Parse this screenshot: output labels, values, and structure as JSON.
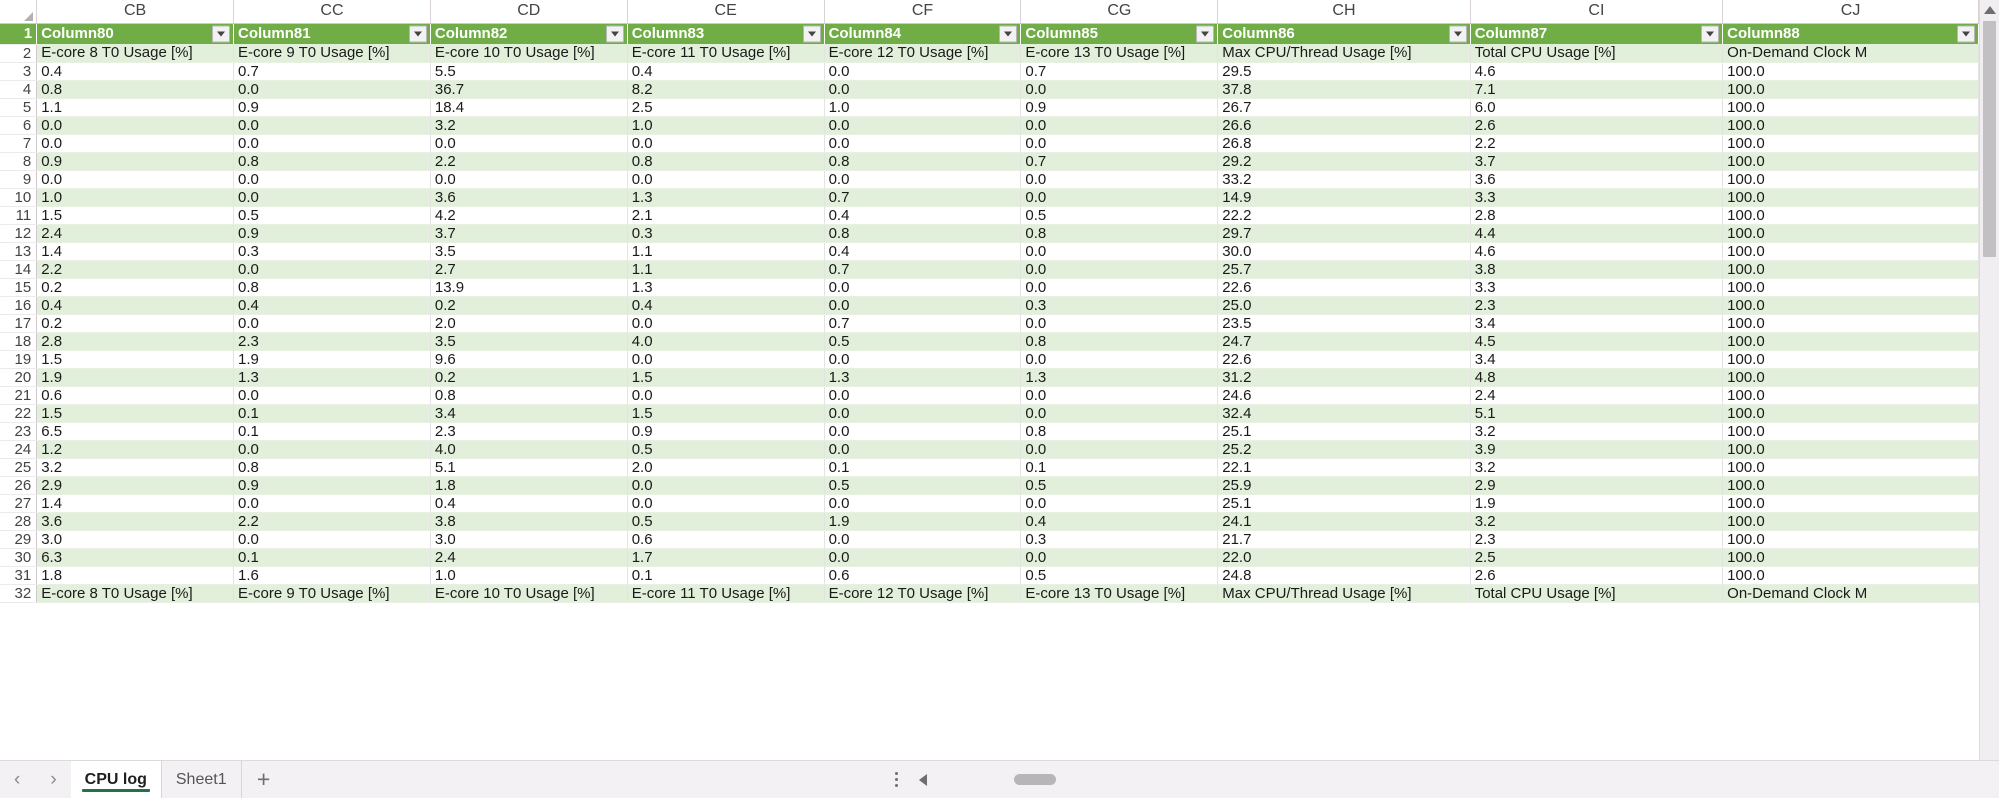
{
  "app": {
    "name": "Microsoft Excel",
    "corner_icon": "select-all-icon"
  },
  "grid": {
    "column_letters": [
      "CB",
      "CC",
      "CD",
      "CE",
      "CF",
      "CG",
      "CH",
      "CI",
      "CJ"
    ],
    "row_numbers": [
      "1",
      "2",
      "3",
      "4",
      "5",
      "6",
      "7",
      "8",
      "9",
      "10",
      "11",
      "12",
      "13",
      "14",
      "15",
      "16",
      "17",
      "18",
      "19",
      "20",
      "21",
      "22",
      "23",
      "24",
      "25",
      "26",
      "27",
      "28",
      "29",
      "30",
      "31",
      "32"
    ],
    "table_headers": [
      "Column80",
      "Column81",
      "Column82",
      "Column83",
      "Column84",
      "Column85",
      "Column86",
      "Column87",
      "Column88"
    ],
    "filter_icon": "filter-dropdown-icon",
    "label_row": [
      "E-core 8 T0 Usage [%]",
      "E-core 9 T0 Usage [%]",
      "E-core 10 T0 Usage [%]",
      "E-core 11 T0 Usage [%]",
      "E-core 12 T0 Usage [%]",
      "E-core 13 T0 Usage [%]",
      "Max CPU/Thread Usage [%]",
      "Total CPU Usage [%]",
      "On-Demand Clock M"
    ],
    "data_rows": [
      [
        "0.4",
        "0.7",
        "5.5",
        "0.4",
        "0.0",
        "0.7",
        "29.5",
        "4.6",
        "100.0"
      ],
      [
        "0.8",
        "0.0",
        "36.7",
        "8.2",
        "0.0",
        "0.0",
        "37.8",
        "7.1",
        "100.0"
      ],
      [
        "1.1",
        "0.9",
        "18.4",
        "2.5",
        "1.0",
        "0.9",
        "26.7",
        "6.0",
        "100.0"
      ],
      [
        "0.0",
        "0.0",
        "3.2",
        "1.0",
        "0.0",
        "0.0",
        "26.6",
        "2.6",
        "100.0"
      ],
      [
        "0.0",
        "0.0",
        "0.0",
        "0.0",
        "0.0",
        "0.0",
        "26.8",
        "2.2",
        "100.0"
      ],
      [
        "0.9",
        "0.8",
        "2.2",
        "0.8",
        "0.8",
        "0.7",
        "29.2",
        "3.7",
        "100.0"
      ],
      [
        "0.0",
        "0.0",
        "0.0",
        "0.0",
        "0.0",
        "0.0",
        "33.2",
        "3.6",
        "100.0"
      ],
      [
        "1.0",
        "0.0",
        "3.6",
        "1.3",
        "0.7",
        "0.0",
        "14.9",
        "3.3",
        "100.0"
      ],
      [
        "1.5",
        "0.5",
        "4.2",
        "2.1",
        "0.4",
        "0.5",
        "22.2",
        "2.8",
        "100.0"
      ],
      [
        "2.4",
        "0.9",
        "3.7",
        "0.3",
        "0.8",
        "0.8",
        "29.7",
        "4.4",
        "100.0"
      ],
      [
        "1.4",
        "0.3",
        "3.5",
        "1.1",
        "0.4",
        "0.0",
        "30.0",
        "4.6",
        "100.0"
      ],
      [
        "2.2",
        "0.0",
        "2.7",
        "1.1",
        "0.7",
        "0.0",
        "25.7",
        "3.8",
        "100.0"
      ],
      [
        "0.2",
        "0.8",
        "13.9",
        "1.3",
        "0.0",
        "0.0",
        "22.6",
        "3.3",
        "100.0"
      ],
      [
        "0.4",
        "0.4",
        "0.2",
        "0.4",
        "0.0",
        "0.3",
        "25.0",
        "2.3",
        "100.0"
      ],
      [
        "0.2",
        "0.0",
        "2.0",
        "0.0",
        "0.7",
        "0.0",
        "23.5",
        "3.4",
        "100.0"
      ],
      [
        "2.8",
        "2.3",
        "3.5",
        "4.0",
        "0.5",
        "0.8",
        "24.7",
        "4.5",
        "100.0"
      ],
      [
        "1.5",
        "1.9",
        "9.6",
        "0.0",
        "0.0",
        "0.0",
        "22.6",
        "3.4",
        "100.0"
      ],
      [
        "1.9",
        "1.3",
        "0.2",
        "1.5",
        "1.3",
        "1.3",
        "31.2",
        "4.8",
        "100.0"
      ],
      [
        "0.6",
        "0.0",
        "0.8",
        "0.0",
        "0.0",
        "0.0",
        "24.6",
        "2.4",
        "100.0"
      ],
      [
        "1.5",
        "0.1",
        "3.4",
        "1.5",
        "0.0",
        "0.0",
        "32.4",
        "5.1",
        "100.0"
      ],
      [
        "6.5",
        "0.1",
        "2.3",
        "0.9",
        "0.0",
        "0.8",
        "25.1",
        "3.2",
        "100.0"
      ],
      [
        "1.2",
        "0.0",
        "4.0",
        "0.5",
        "0.0",
        "0.0",
        "25.2",
        "3.9",
        "100.0"
      ],
      [
        "3.2",
        "0.8",
        "5.1",
        "2.0",
        "0.1",
        "0.1",
        "22.1",
        "3.2",
        "100.0"
      ],
      [
        "2.9",
        "0.9",
        "1.8",
        "0.0",
        "0.5",
        "0.5",
        "25.9",
        "2.9",
        "100.0"
      ],
      [
        "1.4",
        "0.0",
        "0.4",
        "0.0",
        "0.0",
        "0.0",
        "25.1",
        "1.9",
        "100.0"
      ],
      [
        "3.6",
        "2.2",
        "3.8",
        "0.5",
        "1.9",
        "0.4",
        "24.1",
        "3.2",
        "100.0"
      ],
      [
        "3.0",
        "0.0",
        "3.0",
        "0.6",
        "0.0",
        "0.3",
        "21.7",
        "2.3",
        "100.0"
      ],
      [
        "6.3",
        "0.1",
        "2.4",
        "1.7",
        "0.0",
        "0.0",
        "22.0",
        "2.5",
        "100.0"
      ],
      [
        "1.8",
        "1.6",
        "1.0",
        "0.1",
        "0.6",
        "0.5",
        "24.8",
        "2.6",
        "100.0"
      ]
    ]
  },
  "sheetbar": {
    "prev_label": "‹",
    "next_label": "›",
    "tabs": [
      {
        "label": "CPU log",
        "active": true
      },
      {
        "label": "Sheet1",
        "active": false
      }
    ],
    "add_sheet_label": "+",
    "kebab_icon": "more-options-icon",
    "hscroll_left_icon": "scroll-left-icon"
  },
  "colors": {
    "table_header_green": "#70ad47",
    "band_green": "#e2efda",
    "tab_accent": "#217346"
  }
}
